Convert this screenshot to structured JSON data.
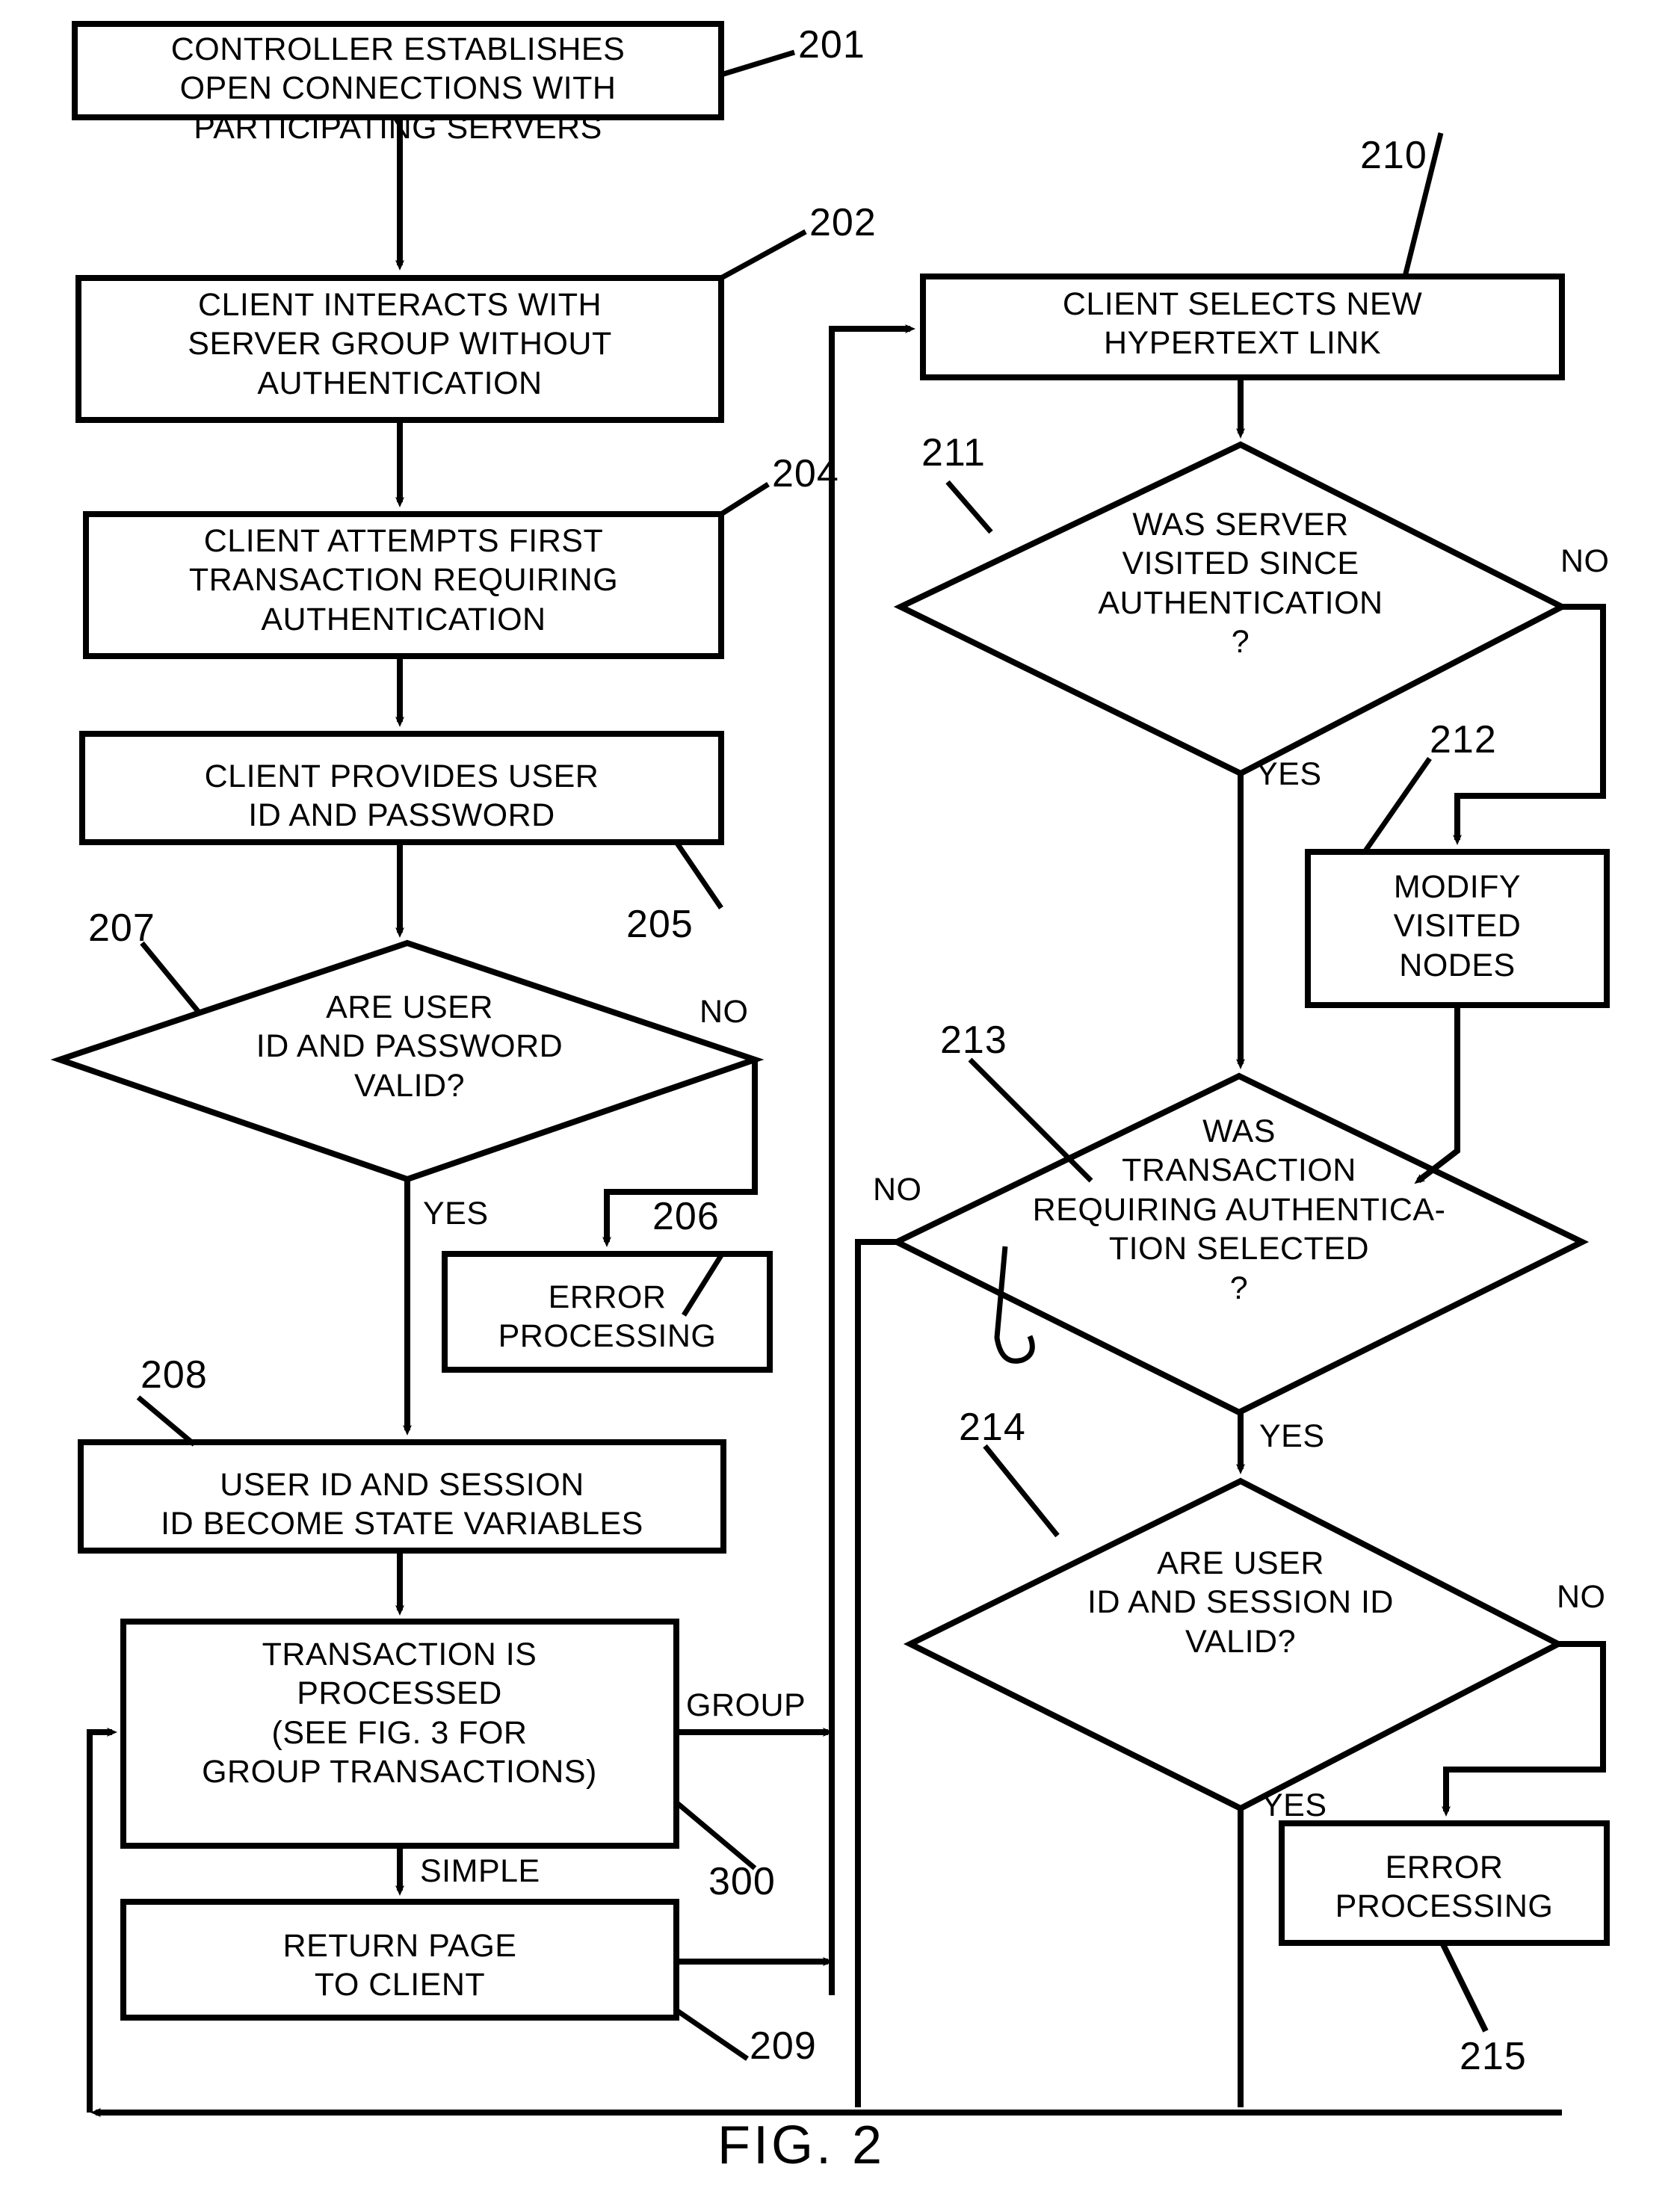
{
  "figure": {
    "caption": "FIG. 2",
    "type": "flowchart"
  },
  "nodes": [
    {
      "id": "201",
      "shape": "process",
      "text": "CONTROLLER ESTABLISHES\nOPEN CONNECTIONS WITH\nPARTICIPATING SERVERS"
    },
    {
      "id": "202",
      "shape": "process",
      "text": "CLIENT INTERACTS WITH\nSERVER GROUP WITHOUT\nAUTHENTICATION"
    },
    {
      "id": "204",
      "shape": "process",
      "text": "CLIENT ATTEMPTS FIRST\nTRANSACTION REQUIRING\nAUTHENTICATION"
    },
    {
      "id": "205",
      "shape": "process",
      "text": "CLIENT PROVIDES USER\nID AND PASSWORD"
    },
    {
      "id": "207",
      "shape": "decision",
      "text": "ARE USER\nID AND PASSWORD\nVALID?"
    },
    {
      "id": "206",
      "shape": "process",
      "text": "ERROR\nPROCESSING"
    },
    {
      "id": "208",
      "shape": "process",
      "text": "USER ID AND SESSION\nID BECOME STATE VARIABLES"
    },
    {
      "id": "300",
      "shape": "process",
      "text": "TRANSACTION IS\nPROCESSED\n(SEE FIG. 3 FOR\nGROUP  TRANSACTIONS)"
    },
    {
      "id": "209",
      "shape": "process",
      "text": "RETURN PAGE\nTO CLIENT"
    },
    {
      "id": "210",
      "shape": "process",
      "text": "CLIENT SELECTS NEW\nHYPERTEXT LINK"
    },
    {
      "id": "211",
      "shape": "decision",
      "text": "WAS SERVER\nVISITED  SINCE\nAUTHENTICATION\n?"
    },
    {
      "id": "212",
      "shape": "process",
      "text": "MODIFY\nVISITED\nNODES"
    },
    {
      "id": "213",
      "shape": "decision",
      "text": "WAS\nTRANSACTION\nREQUIRING AUTHENTICA-\nTION SELECTED\n?"
    },
    {
      "id": "214",
      "shape": "decision",
      "text": "ARE USER\nID AND  SESSION ID\nVALID?"
    },
    {
      "id": "215",
      "shape": "process",
      "text": "ERROR\nPROCESSING"
    }
  ],
  "reference_numerals": [
    {
      "label": "201"
    },
    {
      "label": "202"
    },
    {
      "label": "204"
    },
    {
      "label": "205"
    },
    {
      "label": "207"
    },
    {
      "label": "206"
    },
    {
      "label": "208"
    },
    {
      "label": "300"
    },
    {
      "label": "209"
    },
    {
      "label": "210"
    },
    {
      "label": "211"
    },
    {
      "label": "212"
    },
    {
      "label": "213"
    },
    {
      "label": "214"
    },
    {
      "label": "215"
    }
  ],
  "edge_labels": {
    "no_207": "NO",
    "yes_207": "YES",
    "group_300": "GROUP",
    "simple_300": "SIMPLE",
    "no_211": "NO",
    "yes_211": "YES",
    "no_213": "NO",
    "yes_213": "YES",
    "no_214": "NO",
    "yes_214": "YES"
  },
  "colors": {
    "stroke": "#000000",
    "background": "#ffffff",
    "text": "#000000"
  }
}
